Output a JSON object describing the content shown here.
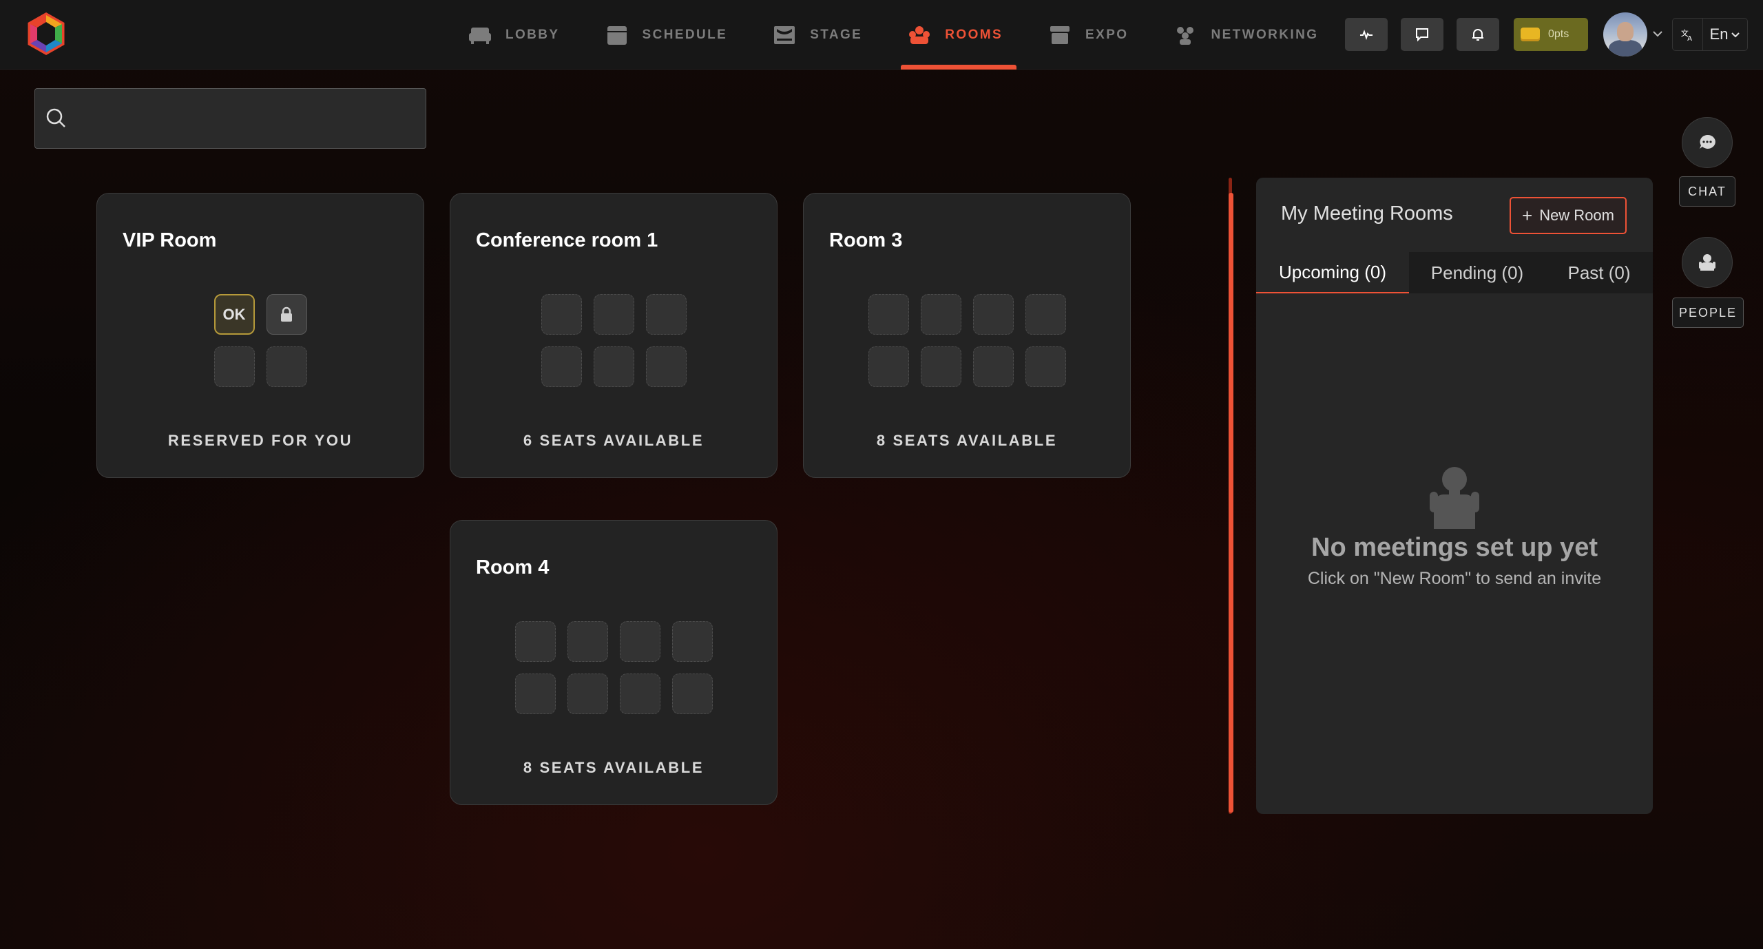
{
  "nav": {
    "items": [
      {
        "label": "LOBBY",
        "icon": "sofa-icon"
      },
      {
        "label": "SCHEDULE",
        "icon": "calendar-icon"
      },
      {
        "label": "STAGE",
        "icon": "stage-icon"
      },
      {
        "label": "ROOMS",
        "icon": "rooms-icon"
      },
      {
        "label": "EXPO",
        "icon": "booth-icon"
      },
      {
        "label": "NETWORKING",
        "icon": "people-group-icon"
      }
    ],
    "active": "ROOMS"
  },
  "toolbar": {
    "points_label": "0pts",
    "language": "En"
  },
  "search": {
    "placeholder": "",
    "value": ""
  },
  "rooms": [
    {
      "title": "VIP Room",
      "status": "RESERVED FOR YOU",
      "seat_ok_label": "OK"
    },
    {
      "title": "Conference room 1",
      "status": "6 SEATS AVAILABLE"
    },
    {
      "title": "Room 3",
      "status": "8 SEATS AVAILABLE"
    },
    {
      "title": "Room 4",
      "status": "8 SEATS AVAILABLE"
    }
  ],
  "meetings_panel": {
    "title": "My Meeting Rooms",
    "new_room_label": "New Room",
    "tabs": [
      "Upcoming (0)",
      "Pending (0)",
      "Past (0)"
    ],
    "active_tab": "Upcoming (0)",
    "empty_title": "No meetings set up yet",
    "empty_subtitle": "Click on \"New Room\" to send an invite"
  },
  "rail": {
    "chat_label": "CHAT",
    "people_label": "PEOPLE"
  },
  "colors": {
    "accent": "#ee5236",
    "panel": "#262626",
    "card": "#232323",
    "points_bg": "#6b6a20"
  }
}
